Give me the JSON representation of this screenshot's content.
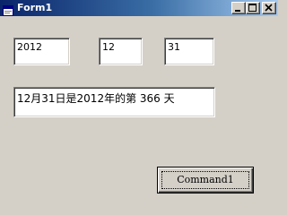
{
  "window": {
    "title": "Form1",
    "icon": "form-icon",
    "caption_buttons": [
      "minimize-icon",
      "maximize-icon",
      "close-icon"
    ]
  },
  "fields": {
    "year": "2012",
    "month": "12",
    "day": "31",
    "result": "12月31日是2012年的第 366 天"
  },
  "button": {
    "label": "Command1"
  },
  "colors": {
    "face": "#d4d0c8",
    "title_start": "#0a246a",
    "title_end": "#a6caf0"
  }
}
